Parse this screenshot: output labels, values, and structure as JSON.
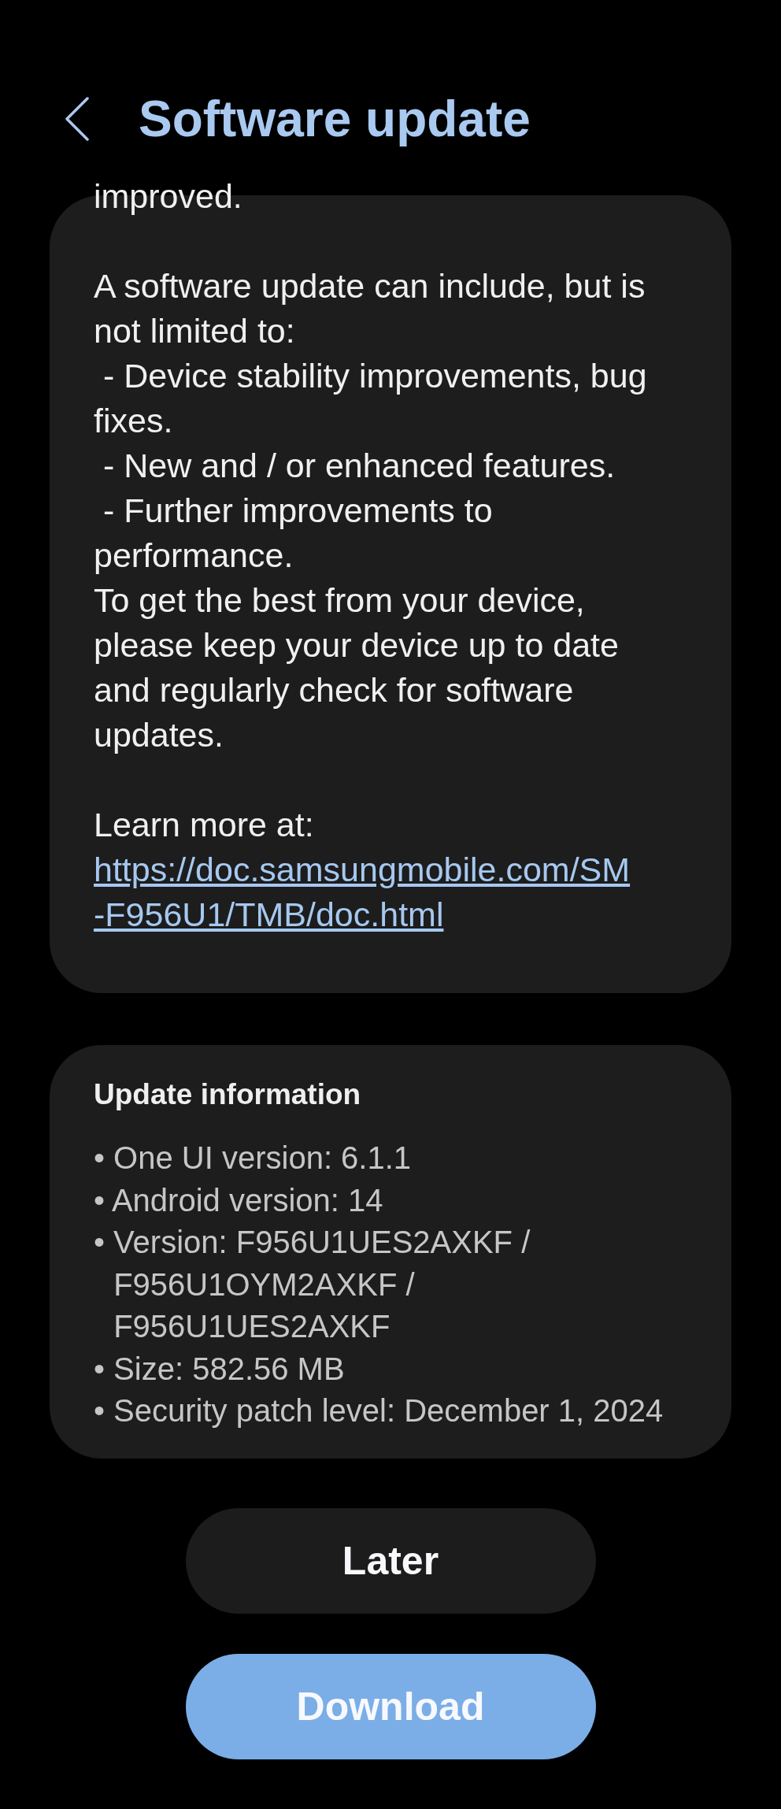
{
  "header": {
    "title": "Software update"
  },
  "release_notes": {
    "blocks": [
      [
        {
          "kind": "text",
          "text": "improved."
        }
      ],
      [
        {
          "kind": "text",
          "text": "A software update can include, but is not limited to:"
        },
        {
          "kind": "text",
          "text": " - Device stability improvements, bug fixes."
        },
        {
          "kind": "text",
          "text": " - New and / or enhanced features."
        },
        {
          "kind": "text",
          "text": " - Further improvements to performance."
        },
        {
          "kind": "text",
          "text": "To get the best from your device, please keep your device up to date and regularly check for software updates."
        }
      ],
      [
        {
          "kind": "text",
          "text": "Learn more at:"
        },
        {
          "kind": "link",
          "text": "https://doc.samsungmobile.com/SM-F956U1/TMB/doc.html"
        }
      ]
    ]
  },
  "update_information": {
    "title": "Update information",
    "items": [
      "• One UI version: 6.1.1",
      "• Android version: 14",
      "• Version: F956U1UES2AXKF / F956U1OYM2AXKF / F956U1UES2AXKF",
      "• Size: 582.56 MB",
      "• Security patch level: December 1, 2024"
    ]
  },
  "buttons": [
    {
      "label": "Later",
      "kind": "secondary"
    },
    {
      "label": "Download",
      "kind": "primary"
    }
  ]
}
